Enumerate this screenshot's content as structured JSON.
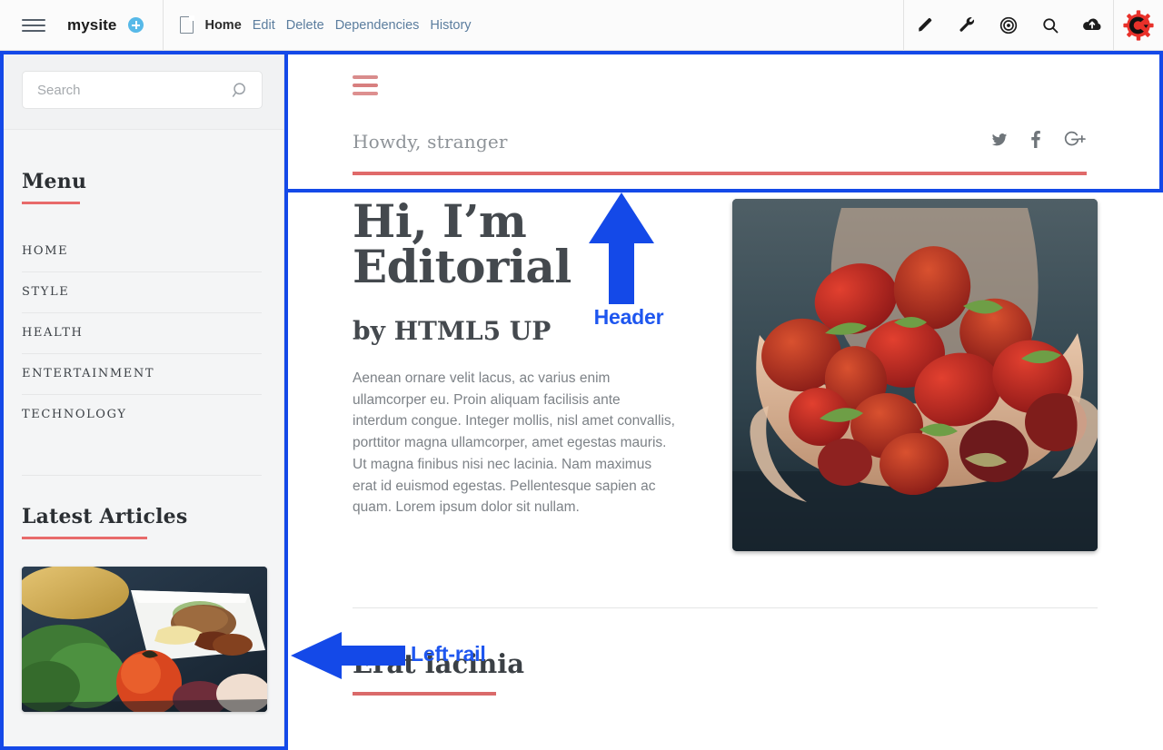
{
  "cms_toolbar": {
    "menu_icon": "hamburger-icon",
    "site_name": "mysite",
    "add_icon": "plus-circle-icon",
    "page_icon": "document-icon",
    "nav": [
      {
        "label": "Home",
        "active": true
      },
      {
        "label": "Edit",
        "active": false
      },
      {
        "label": "Delete",
        "active": false
      },
      {
        "label": "Dependencies",
        "active": false
      },
      {
        "label": "History",
        "active": false
      }
    ],
    "tools": [
      {
        "name": "pencil-icon"
      },
      {
        "name": "wrench-icon"
      },
      {
        "name": "target-icon"
      },
      {
        "name": "search-icon"
      },
      {
        "name": "cloud-upload-icon"
      }
    ],
    "logo": {
      "name": "concrete-cms-gear-logo",
      "letter": "C"
    }
  },
  "sidebar": {
    "search": {
      "placeholder": "Search",
      "value": "",
      "icon": "search-icon"
    },
    "menu_heading": "Menu",
    "menu_items": [
      {
        "label": "HOME"
      },
      {
        "label": "STYLE"
      },
      {
        "label": "HEALTH"
      },
      {
        "label": "ENTERTAINMENT"
      },
      {
        "label": "TECHNOLOGY"
      }
    ],
    "latest_heading": "Latest Articles",
    "latest_thumb_alt": "food-plate-photo"
  },
  "preview": {
    "menu_toggle_icon": "hamburger-icon",
    "greeting": "Howdy, stranger",
    "socials": [
      {
        "name": "twitter-icon",
        "label": "Twitter"
      },
      {
        "name": "facebook-icon",
        "label": "Facebook"
      },
      {
        "name": "google-plus-icon",
        "label": "Google+"
      }
    ],
    "title_line1": "Hi, I’m",
    "title_line2": "Editorial",
    "byline": "by HTML5 UP",
    "body": "Aenean ornare velit lacus, ac varius enim ullamcorper eu. Proin aliquam facilisis ante interdum congue. Integer mollis, nisl amet convallis, porttitor magna ullamcorper, amet egestas mauris. Ut magna finibus nisi nec lacinia. Nam maximus erat id euismod egestas. Pellentesque sapien ac quam. Lorem ipsum dolor sit nullam.",
    "hero_image_alt": "hands-holding-strawberries",
    "section_title": "Erat lacinia"
  },
  "annotations": {
    "header_label": "Header",
    "left_rail_label": "Left-rail",
    "color": "#1449e8"
  },
  "colors": {
    "accent_red": "#e06a6a",
    "annotation_blue": "#1449e8",
    "link_blue": "#5b7d9e",
    "logo_red": "#e8312a"
  }
}
